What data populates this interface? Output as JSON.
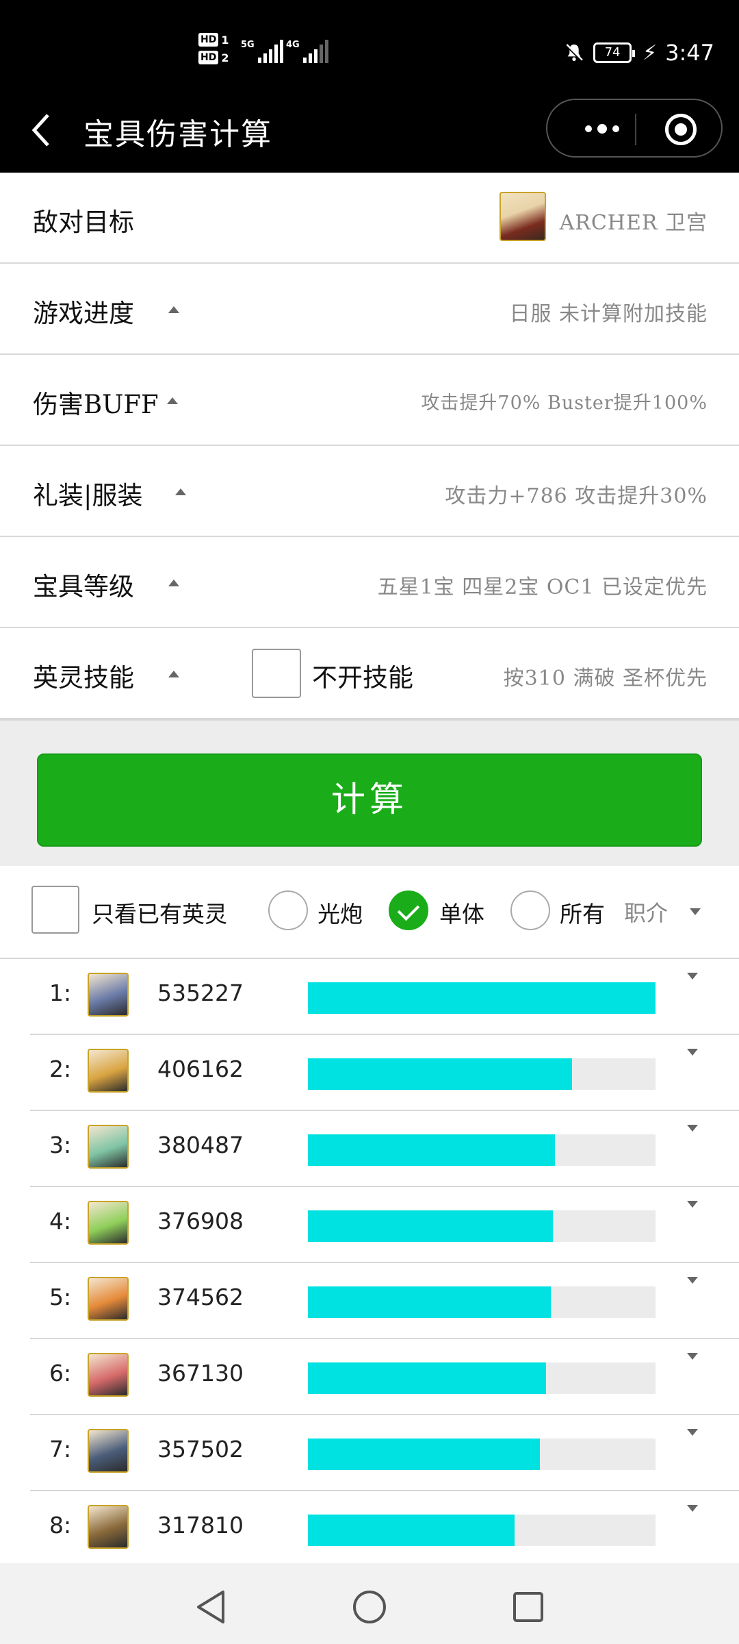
{
  "status_bar": {
    "sim1": "HD",
    "sim1_num": "1",
    "sim2": "HD",
    "sim2_num": "2",
    "net1": "5G",
    "net2": "4G",
    "battery": "74",
    "time": "3:47"
  },
  "header": {
    "title": "宝具伤害计算"
  },
  "settings": [
    {
      "label": "敌对目标",
      "value": "ARCHER 卫宫",
      "icon": "archer-emiya-portrait"
    },
    {
      "label": "游戏进度",
      "value": "日服 未计算附加技能"
    },
    {
      "label": "伤害BUFF",
      "value": "攻击提升70% Buster提升100%"
    },
    {
      "label": "礼装|服装",
      "value": "攻击力+786 攻击提升30%"
    },
    {
      "label": "宝具等级",
      "value": "五星1宝 四星2宝 OC1 已设定优先"
    },
    {
      "label": "英灵技能",
      "checkbox_label": "不开技能",
      "value": "按310 满破 圣杯优先"
    }
  ],
  "calc_button": "计算",
  "filters": {
    "owned_only": "只看已有英灵",
    "aoe": "光炮",
    "single": "单体",
    "all": "所有",
    "class": "职介",
    "selected": "single"
  },
  "ranking": [
    {
      "rank": "1:",
      "score": "535227",
      "ratio": 1.0,
      "avatar_color": "#6a7ba8"
    },
    {
      "rank": "2:",
      "score": "406162",
      "ratio": 0.7589,
      "avatar_color": "#d9a441"
    },
    {
      "rank": "3:",
      "score": "380487",
      "ratio": 0.7109,
      "avatar_color": "#7fc4a4"
    },
    {
      "rank": "4:",
      "score": "376908",
      "ratio": 0.7042,
      "avatar_color": "#8fcf5a"
    },
    {
      "rank": "5:",
      "score": "374562",
      "ratio": 0.6998,
      "avatar_color": "#e58a3a"
    },
    {
      "rank": "6:",
      "score": "367130",
      "ratio": 0.6859,
      "avatar_color": "#d66a6a"
    },
    {
      "rank": "7:",
      "score": "357502",
      "ratio": 0.6679,
      "avatar_color": "#4b5d7a"
    },
    {
      "rank": "8:",
      "score": "317810",
      "ratio": 0.5938,
      "avatar_color": "#8a6a3a"
    }
  ],
  "colors": {
    "accent_green": "#1aad19",
    "bar_fill": "#00e1e1",
    "bar_track": "#ebebeb"
  }
}
